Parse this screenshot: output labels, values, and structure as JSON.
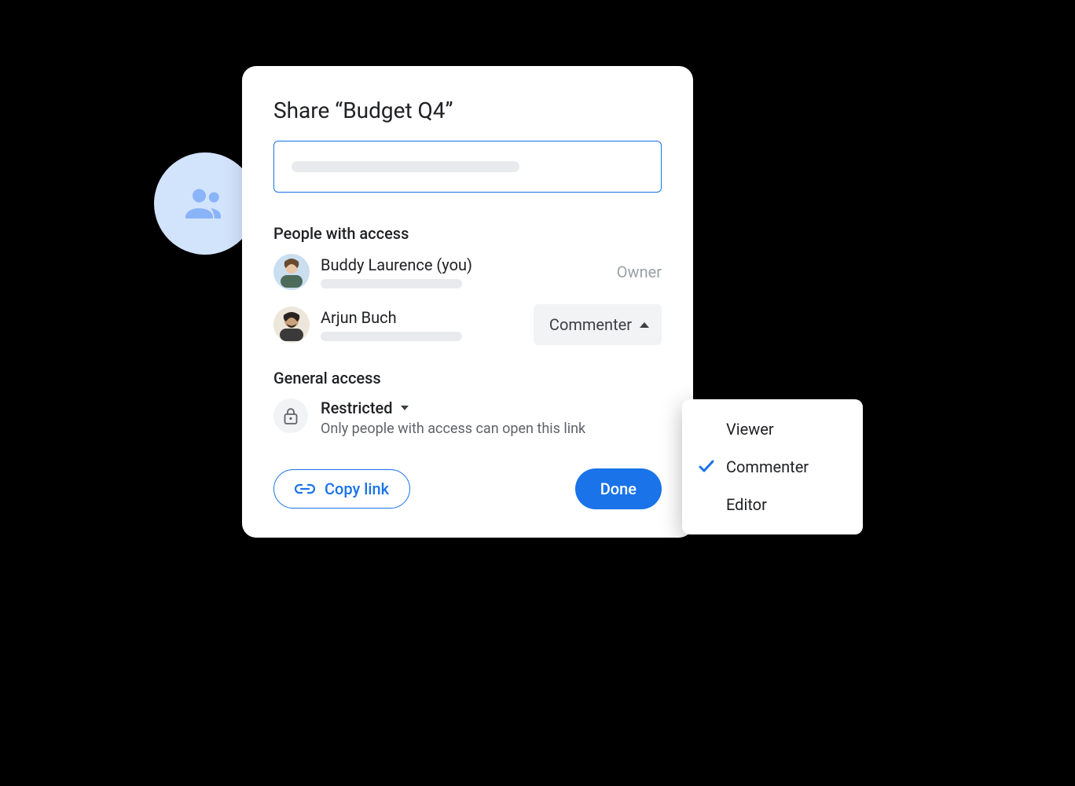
{
  "dialog": {
    "title": "Share “Budget Q4”",
    "people_heading": "People with access",
    "general_heading": "General access",
    "people": [
      {
        "name": "Buddy Laurence (you)",
        "role": "Owner"
      },
      {
        "name": "Arjun Buch",
        "role": "Commenter"
      }
    ],
    "general": {
      "mode": "Restricted",
      "description": "Only people with access can open this link"
    },
    "actions": {
      "copy_link": "Copy link",
      "done": "Done"
    }
  },
  "roles_menu": {
    "options": [
      {
        "label": "Viewer",
        "selected": false
      },
      {
        "label": "Commenter",
        "selected": true
      },
      {
        "label": "Editor",
        "selected": false
      }
    ]
  }
}
